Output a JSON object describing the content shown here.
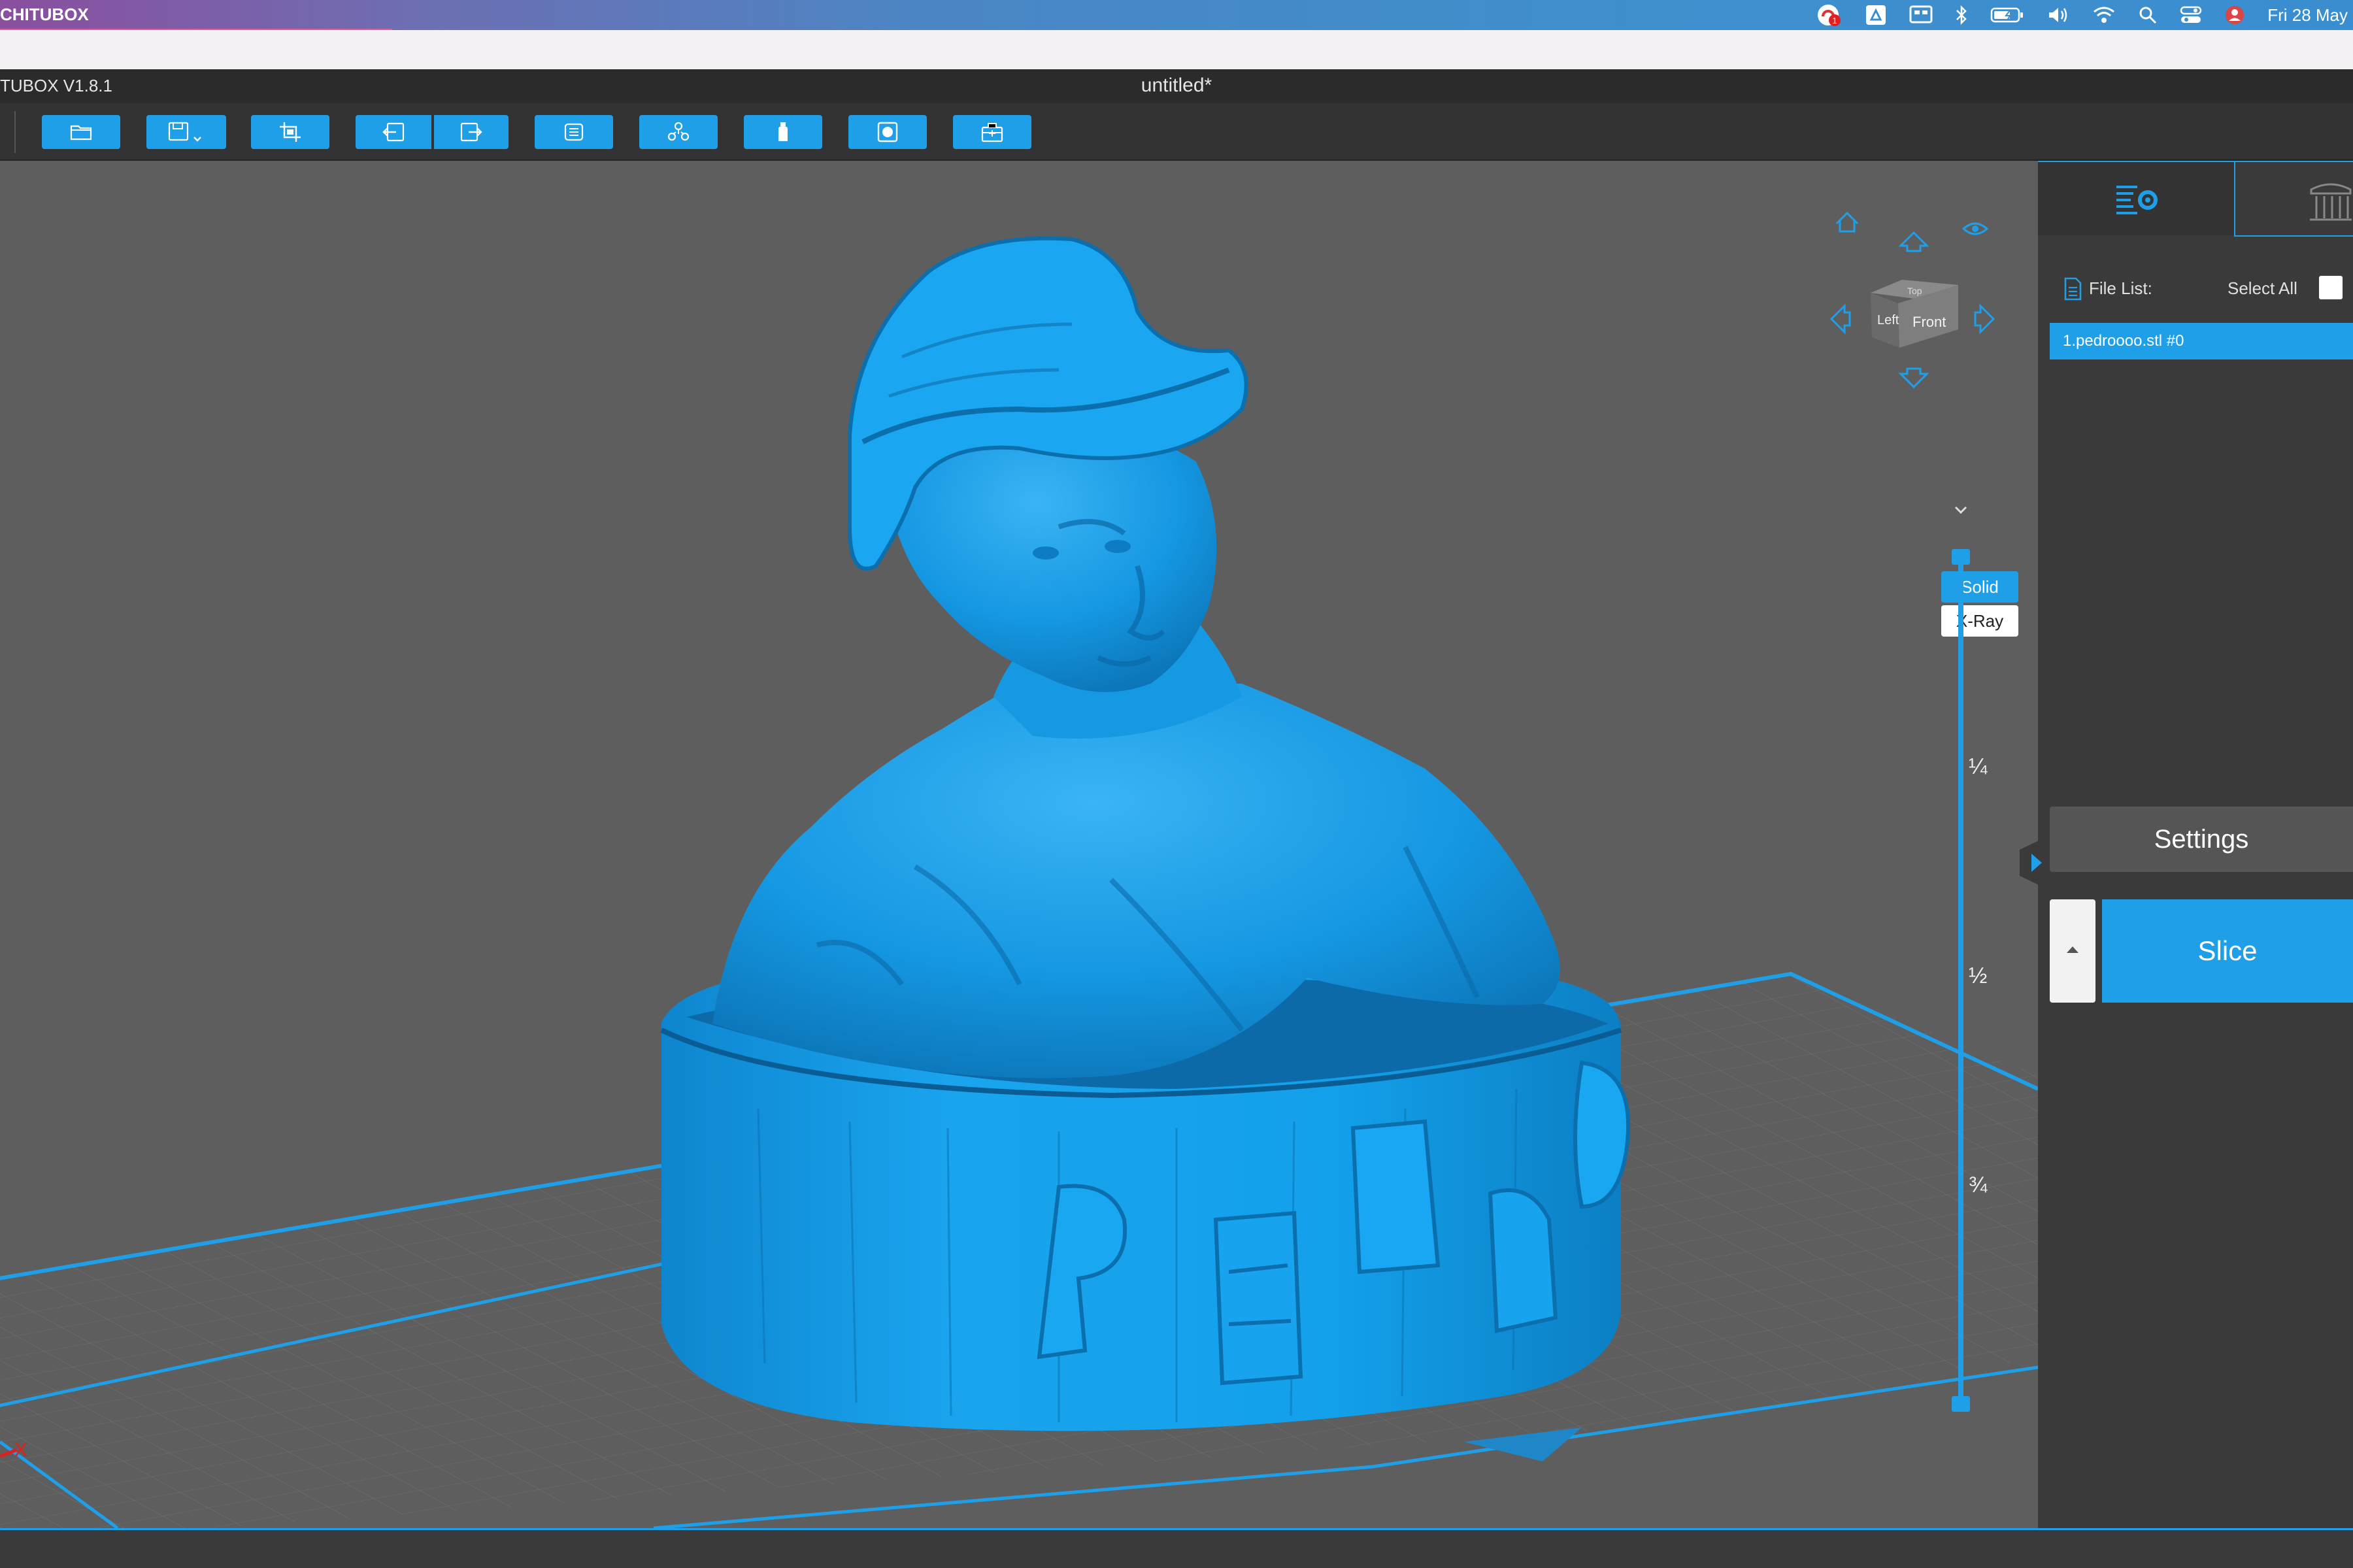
{
  "menubar": {
    "app_name": "CHITUBOX",
    "date": "Fri 28 May",
    "notification_count": "1",
    "icons": [
      "notification-icon",
      "drive-icon",
      "display-icon",
      "bluetooth-icon",
      "battery-icon",
      "volume-icon",
      "wifi-icon",
      "search-icon",
      "control-center-icon",
      "user-icon"
    ]
  },
  "titlebar": {
    "version": "TUBOX V1.8.1",
    "document": "untitled*"
  },
  "toolbar": {
    "buttons": [
      "open-file",
      "save",
      "crop",
      "import-left",
      "export-right",
      "layers",
      "supports-tree",
      "bottle",
      "hollow",
      "package"
    ]
  },
  "view": {
    "solid_label": "Solid",
    "xray_label": "X-Ray",
    "cube_left": "Left",
    "cube_front": "Front",
    "cube_top": "Top",
    "layer_marks": [
      "¼",
      "½",
      "¾"
    ],
    "axis_x": "X"
  },
  "panel": {
    "file_list_label": "File List:",
    "select_all_label": "Select All",
    "files": [
      "1.pedroooo.stl #0"
    ],
    "settings_label": "Settings",
    "slice_label": "Slice"
  },
  "colors": {
    "accent": "#1f9fe8",
    "model": "#1a9fe6",
    "toolbar_bg": "#333333"
  }
}
